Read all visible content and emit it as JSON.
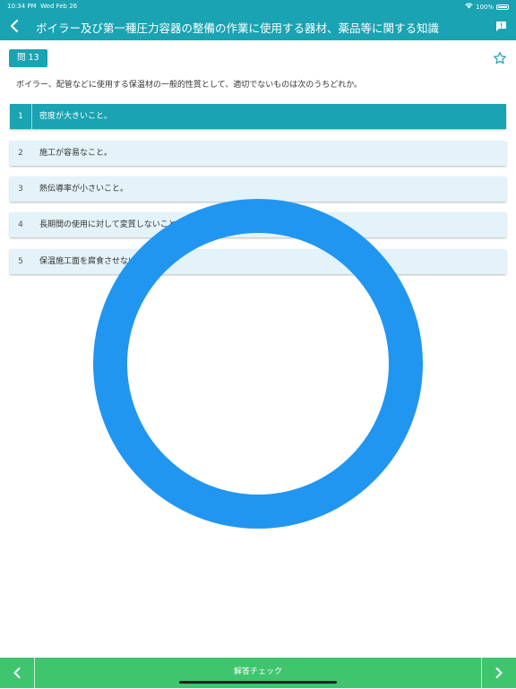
{
  "status": {
    "time": "10:34 PM",
    "date": "Wed Feb 26",
    "battery": "100%"
  },
  "header": {
    "title": "ボイラー及び第一種圧力容器の整備の作業に使用する器材、薬品等に関する知識"
  },
  "question": {
    "badge": "問 13",
    "text": "ボイラー、配管などに使用する保温材の一般的性質として、適切でないものは次のうちどれか。"
  },
  "choices": [
    {
      "num": "1",
      "text": "密度が大きいこと。",
      "selected": true
    },
    {
      "num": "2",
      "text": "施工が容易なこと。",
      "selected": false
    },
    {
      "num": "3",
      "text": "熱伝導率が小さいこと。",
      "selected": false
    },
    {
      "num": "4",
      "text": "長期間の使用に対して変質しないこと。",
      "selected": false
    },
    {
      "num": "5",
      "text": "保温施工面を腐食させないこと。",
      "selected": false
    }
  ],
  "footer": {
    "check_label": "解答チェック"
  },
  "colors": {
    "teal": "#1aa3b2",
    "green": "#3ec56e",
    "spinner": "#2196f0"
  }
}
